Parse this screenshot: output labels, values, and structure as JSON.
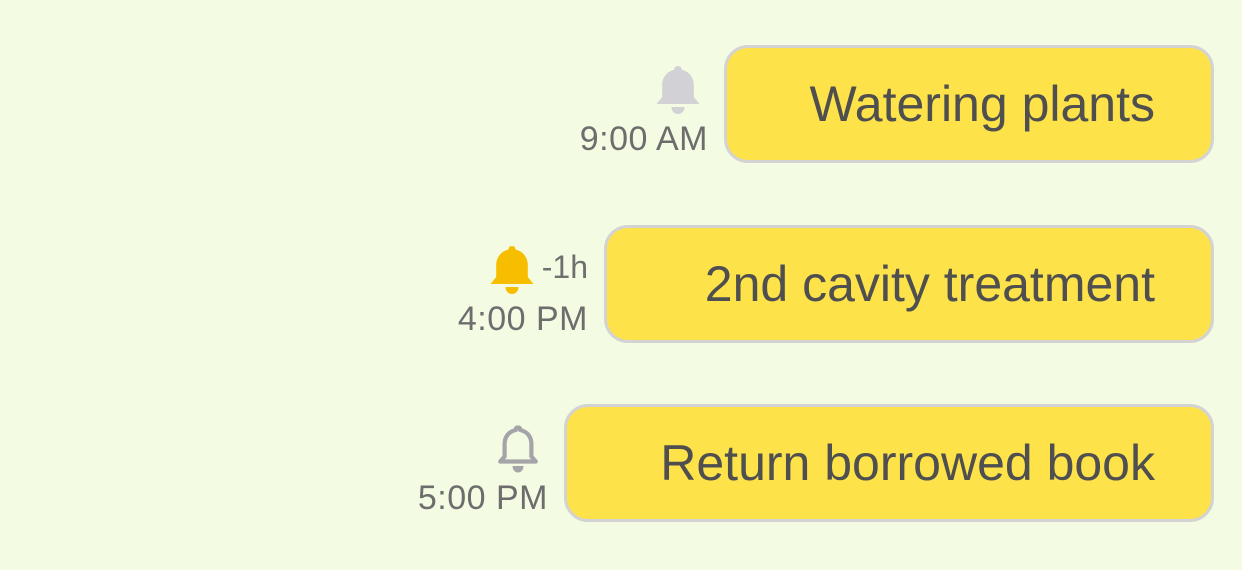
{
  "reminders": [
    {
      "title": "Watering plants",
      "time": "9:00 AM",
      "offset": "",
      "bell_state": "filled-inactive",
      "bell_icon": "bell-filled-icon",
      "bell_color": "#d1d1d6"
    },
    {
      "title": "2nd cavity treatment",
      "time": "4:00 PM",
      "offset": "-1h",
      "bell_state": "filled-active",
      "bell_icon": "bell-filled-icon",
      "bell_color": "#f7be00"
    },
    {
      "title": "Return borrowed book",
      "time": "5:00 PM",
      "offset": "",
      "bell_state": "outline",
      "bell_icon": "bell-outline-icon",
      "bell_color": "#a4a4a9"
    }
  ],
  "colors": {
    "background": "#f3fce3",
    "bubble": "#fde24a",
    "bubble_border": "#d3d3d3",
    "text": "#4f4f4f",
    "meta_text": "#6d6d6d"
  }
}
